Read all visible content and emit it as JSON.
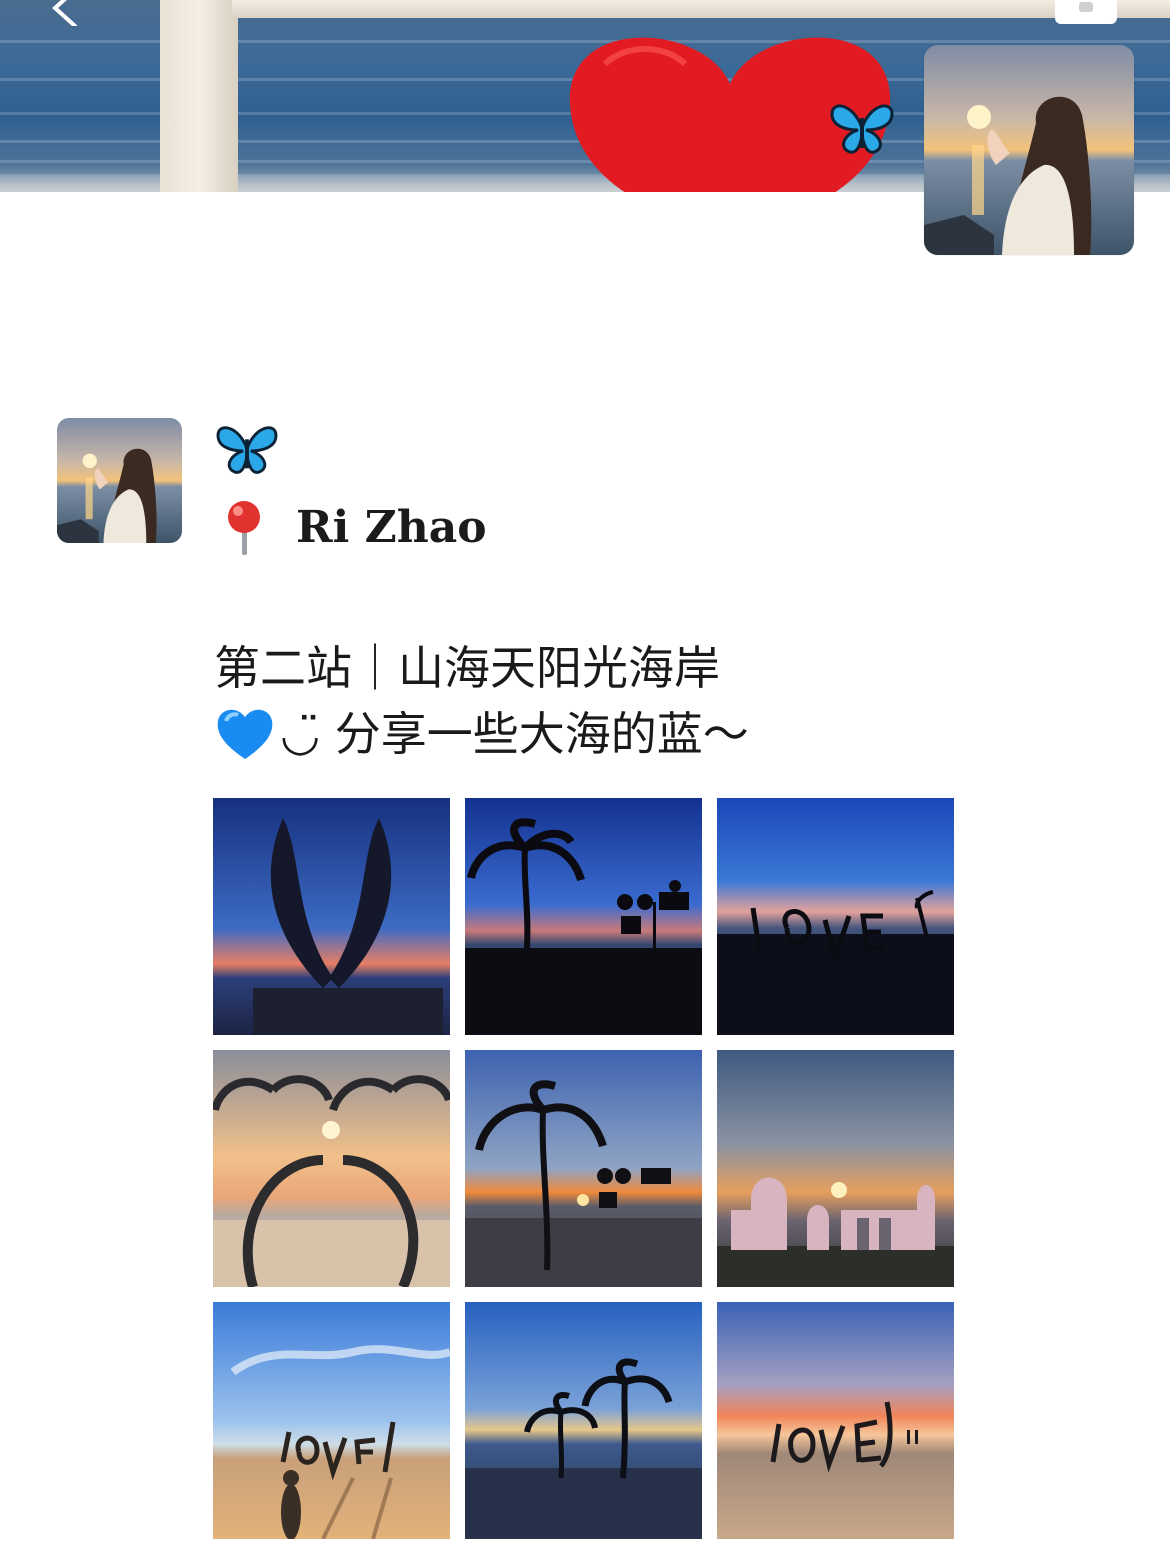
{
  "cover": {
    "image": "sea-cover-with-red-heart",
    "decoration": "butterfly-icon"
  },
  "profile": {
    "avatar": "sunset-heart-hands-photo"
  },
  "post": {
    "avatar": "sunset-heart-hands-photo",
    "nickname_icon": "butterfly-icon",
    "location_icon": "pin-icon",
    "location": "Ri Zhao",
    "line1": "第二站｜山海天阳光海岸",
    "line2_icon": "blue-heart-icon",
    "line2": "◡̈ 分享一些大海的蓝～"
  },
  "photos": [
    {
      "name": "wings-sculpture-twilight"
    },
    {
      "name": "palm-tree-dusk"
    },
    {
      "name": "love-letters-dusk"
    },
    {
      "name": "palm-arch-sunrise"
    },
    {
      "name": "palm-tree-sunrise"
    },
    {
      "name": "arches-sunrise"
    },
    {
      "name": "love-letters-shadow-day"
    },
    {
      "name": "twin-palms-dusk"
    },
    {
      "name": "love-letters-sunset"
    }
  ]
}
